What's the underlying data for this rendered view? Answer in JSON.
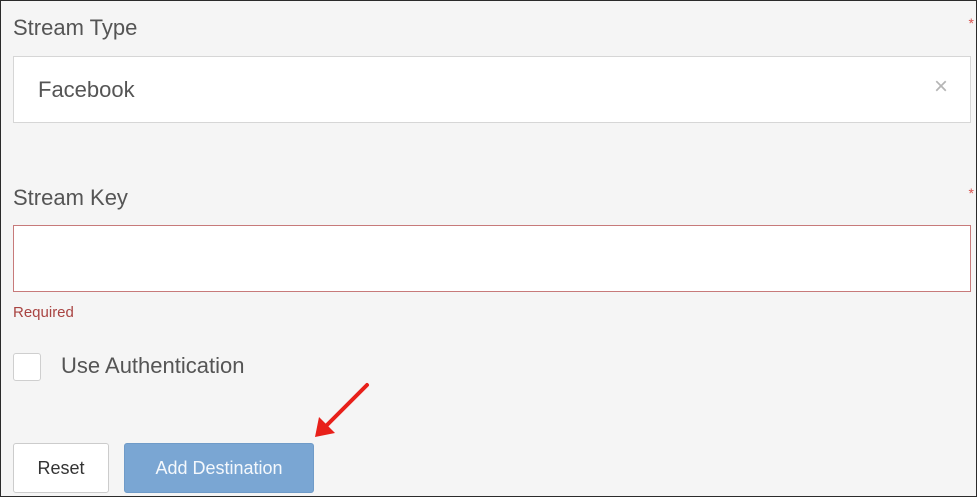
{
  "stream_type": {
    "label": "Stream Type",
    "required_marker": "*",
    "selected_value": "Facebook",
    "clear_glyph": "×"
  },
  "stream_key": {
    "label": "Stream Key",
    "required_marker": "*",
    "value": "",
    "placeholder": "",
    "error": "Required"
  },
  "use_authentication": {
    "label": "Use Authentication",
    "checked": false
  },
  "buttons": {
    "reset_label": "Reset",
    "add_destination_label": "Add Destination"
  },
  "annotation": {
    "arrow_color": "#e8201a"
  }
}
